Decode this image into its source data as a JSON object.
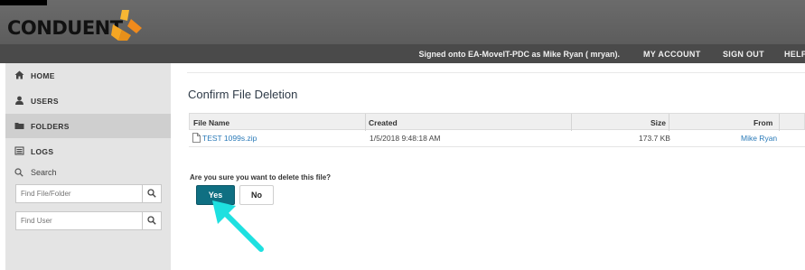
{
  "brand": {
    "name": "CONDUENT"
  },
  "header": {
    "signed_in": "Signed onto EA-MoveIT-PDC as Mike Ryan ( mryan).",
    "links": [
      "MY ACCOUNT",
      "SIGN OUT",
      "HELP"
    ]
  },
  "sidebar": {
    "items": [
      {
        "label": "HOME",
        "icon": "home-icon"
      },
      {
        "label": "USERS",
        "icon": "user-icon"
      },
      {
        "label": "FOLDERS",
        "icon": "folder-icon"
      },
      {
        "label": "LOGS",
        "icon": "log-icon"
      }
    ],
    "search_label": "Search",
    "find_file_placeholder": "Find File/Folder",
    "find_user_placeholder": "Find User"
  },
  "main": {
    "title": "Confirm File Deletion",
    "table": {
      "columns": [
        "File Name",
        "Created",
        "Size",
        "From"
      ],
      "rows": [
        {
          "file_name": "TEST 1099s.zip",
          "created": "1/5/2018 9:48:18 AM",
          "size": "173.7 KB",
          "from": "Mike Ryan"
        }
      ]
    },
    "confirm_question": "Are you sure you want to delete this file?",
    "yes_label": "Yes",
    "no_label": "No"
  },
  "colors": {
    "accent": "#0f6f82",
    "annotation_arrow": "#1ee0e0",
    "logo_orange": "#f5a623"
  }
}
